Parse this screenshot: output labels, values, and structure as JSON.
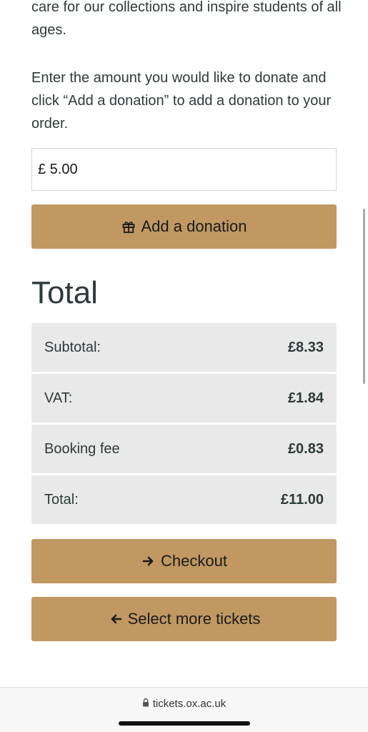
{
  "intro": {
    "paragraph_1": "care for our collections and inspire students of all ages.",
    "paragraph_2": "Enter the amount you would like to donate and click “Add a donation” to add a donation to your order."
  },
  "donation": {
    "value": "£ 5.00",
    "button_label": "Add a donation",
    "button_icon": "gift-icon"
  },
  "totals": {
    "heading": "Total",
    "rows": [
      {
        "label": "Subtotal:",
        "value": "£8.33"
      },
      {
        "label": "VAT:",
        "value": "£1.84"
      },
      {
        "label": "Booking fee",
        "value": "£0.83"
      },
      {
        "label": "Total:",
        "value": "£11.00"
      }
    ]
  },
  "actions": {
    "checkout_label": "Checkout",
    "checkout_icon": "arrow-right-icon",
    "more_label": "Select more tickets",
    "more_icon": "arrow-left-icon"
  },
  "browser": {
    "url": "tickets.ox.ac.uk",
    "lock_icon": "lock-icon"
  },
  "colors": {
    "button": "#c19862",
    "row_background": "#e9e9e9",
    "text": "#2e3b3a"
  }
}
